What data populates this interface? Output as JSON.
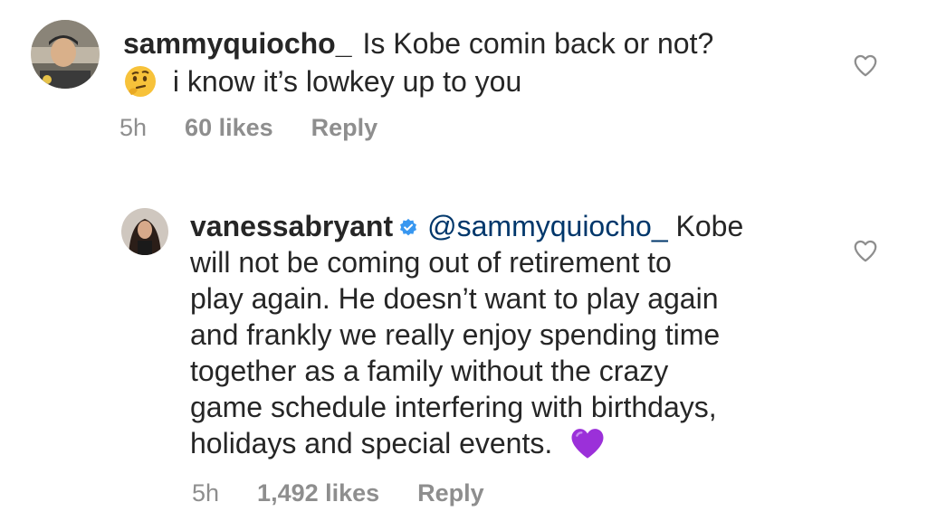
{
  "comments": [
    {
      "username": "sammyquiocho_",
      "text_line1": "Is Kobe comin back or not?",
      "text_line2": "i know it’s lowkey up to you",
      "emoji": "thinking-face",
      "time": "5h",
      "likes": "60 likes",
      "reply": "Reply"
    },
    {
      "username": "vanessabryant",
      "verified": true,
      "mention": "@sammyquiocho_",
      "text_first": "Kobe",
      "lines": [
        "will not be coming out of retirement to",
        "play again. He doesn’t want to play again",
        "and frankly we really enjoy spending time",
        "together as a family without the crazy",
        "game schedule interfering with birthdays,",
        "holidays and special events."
      ],
      "emoji": "purple-heart",
      "time": "5h",
      "likes": "1,492 likes",
      "reply": "Reply"
    }
  ],
  "colors": {
    "text": "#262626",
    "muted": "#8e8e8e",
    "mention": "#00376b",
    "verified": "#3897f0",
    "heart_emoji": "#9b30d9"
  }
}
